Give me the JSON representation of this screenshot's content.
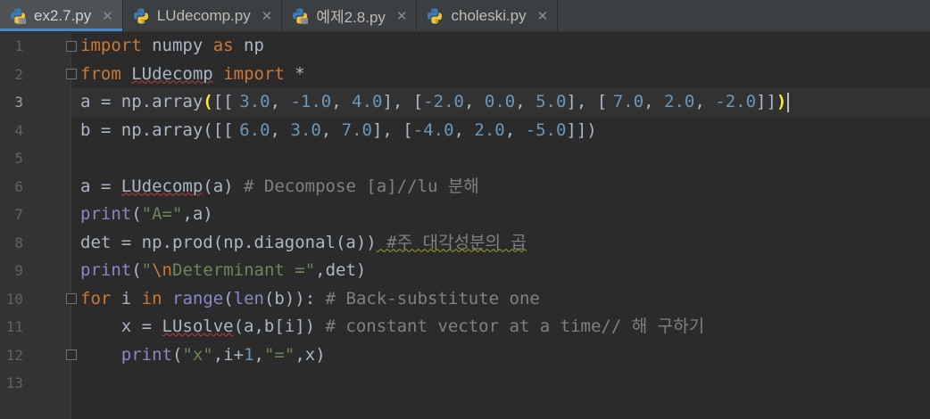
{
  "tabs": [
    {
      "label": "ex2.7.py",
      "active": true,
      "icon": "python-file-icon"
    },
    {
      "label": "LUdecomp.py",
      "active": false,
      "icon": "python-file-icon"
    },
    {
      "label": "예제2.8.py",
      "active": false,
      "icon": "python-file-icon"
    },
    {
      "label": "choleski.py",
      "active": false,
      "icon": "python-file-icon"
    }
  ],
  "close_glyph": "✕",
  "line_numbers": [
    "1",
    "2",
    "3",
    "4",
    "5",
    "6",
    "7",
    "8",
    "9",
    "10",
    "11",
    "12",
    "13"
  ],
  "code": {
    "l1": {
      "kw1": "import",
      "t1": " numpy ",
      "kw2": "as",
      "t2": " np"
    },
    "l2": {
      "kw1": "from",
      "t1": " ",
      "mod": "LUdecomp",
      "t2": " ",
      "kw2": "import",
      "t3": " *"
    },
    "l3": {
      "t1": "a = np.array",
      "open": "(",
      "t2": "[[",
      "n1": "3.0",
      "c1": ", ",
      "n2": "-1.0",
      "c2": ", ",
      "n3": "4.0",
      "t3": "], [",
      "n4": "-2.0",
      "c3": ", ",
      "n5": "0.0",
      "c4": ", ",
      "n6": "5.0",
      "t4": "], [",
      "n7": "7.0",
      "c5": ", ",
      "n8": "2.0",
      "c6": ", ",
      "n9": "-2.0",
      "t5": "]]",
      "close": ")"
    },
    "l4": {
      "t1": "b = np.array([[",
      "n1": "6.0",
      "c1": ", ",
      "n2": "3.0",
      "c2": ", ",
      "n3": "7.0",
      "t2": "], [",
      "n4": "-4.0",
      "c3": ", ",
      "n5": "2.0",
      "c4": ", ",
      "n6": "-5.0",
      "t3": "]])"
    },
    "l6": {
      "t1": "a = ",
      "fn": "LUdecomp",
      "t2": "(a)",
      "cm": " # Decompose [a]//lu 분해"
    },
    "l7": {
      "bi": "print",
      "t1": "(",
      "s1": "\"A=\"",
      "t2": ",a)"
    },
    "l8": {
      "t1": "det = np.prod(np.diagonal(a))",
      "cm": " #주 대각성분의 곱"
    },
    "l9": {
      "bi": "print",
      "t1": "(",
      "s1": "\"",
      "esc": "\\n",
      "s2": "Determinant =\"",
      "t2": ",det)"
    },
    "l10": {
      "kw1": "for",
      "t1": " i ",
      "kw2": "in",
      "t2": " ",
      "bi1": "range",
      "t3": "(",
      "bi2": "len",
      "t4": "(b)):",
      "cm": " # Back-substitute one"
    },
    "l11": {
      "t1": "    x = ",
      "fn": "LUsolve",
      "t2": "(a,b[i])",
      "cm": " # constant vector at a time// 해 구하기"
    },
    "l12": {
      "t1": "    ",
      "bi": "print",
      "t2": "(",
      "s1": "\"x\"",
      "t3": ",i+",
      "n1": "1",
      "t4": ",",
      "s2": "\"=\"",
      "t5": ",x)"
    }
  }
}
